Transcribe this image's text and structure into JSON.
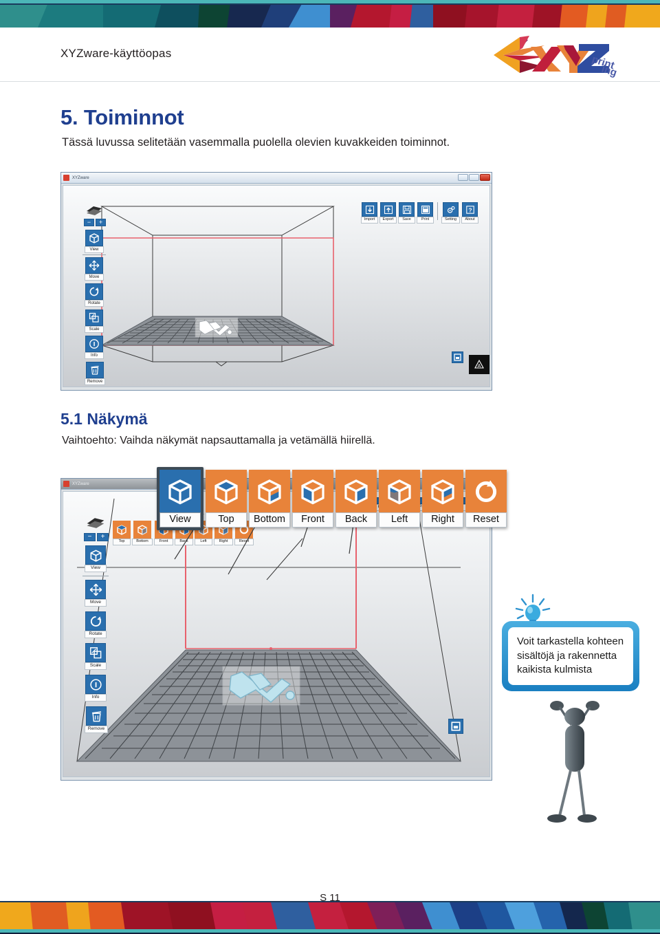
{
  "document": {
    "header_title": "XYZware-käyttöopas",
    "logo_text": "XYZprinting",
    "footer_page": "S 11"
  },
  "section": {
    "number_title": "5. Toiminnot",
    "intro": "Tässä luvussa selitetään vasemmalla puolella olevien kuvakkeiden toiminnot.",
    "sub_number_title": "5.1 Näkymä",
    "sub_intro": "Vaihtoehto: Vaihda näkymät napsauttamalla ja vetämällä hiirellä."
  },
  "app": {
    "window_title": "XYZware",
    "titlebar_buttons": [
      "minimize",
      "maximize",
      "close"
    ],
    "left_rail": {
      "zoom_out": "−",
      "zoom_in": "+",
      "items": [
        {
          "label": "View",
          "icon": "cube-icon"
        },
        {
          "label": "Move",
          "icon": "move-arrows-icon"
        },
        {
          "label": "Rotate",
          "icon": "rotate-icon"
        },
        {
          "label": "Scale",
          "icon": "scale-icon"
        },
        {
          "label": "Info",
          "icon": "info-icon"
        },
        {
          "label": "Remove",
          "icon": "trash-icon"
        }
      ]
    },
    "top_toolbar": [
      {
        "label": "Import",
        "icon": "import-arrow-down-icon"
      },
      {
        "label": "Export",
        "icon": "export-arrow-up-icon"
      },
      {
        "label": "Save",
        "icon": "floppy-disk-icon"
      },
      {
        "label": "Print",
        "icon": "printer-icon"
      },
      {
        "label": "Setting",
        "icon": "gear-icon"
      },
      {
        "label": "About",
        "icon": "question-mark-icon"
      }
    ],
    "top_toolbar_alt": [
      {
        "label": "Import",
        "icon": "import-arrow-down-icon"
      },
      {
        "label": "Export",
        "icon": "export-arrow-up-icon"
      },
      {
        "label": "Save",
        "icon": "floppy-disk-icon"
      },
      {
        "label": "Print",
        "icon": "printer-icon"
      },
      {
        "label": "Settings",
        "icon": "gear-icon"
      },
      {
        "label": "About",
        "icon": "question-mark-icon"
      }
    ],
    "corner_widget": "fit-to-platform-icon",
    "watermark": "A"
  },
  "view_bar": {
    "buttons": [
      {
        "label": "View",
        "icon": "cube-icon",
        "state": "active"
      },
      {
        "label": "Top",
        "icon": "cube-top-icon",
        "state": "normal"
      },
      {
        "label": "Bottom",
        "icon": "cube-bottom-icon",
        "state": "normal"
      },
      {
        "label": "Front",
        "icon": "cube-front-icon",
        "state": "normal"
      },
      {
        "label": "Back",
        "icon": "cube-back-icon",
        "state": "normal"
      },
      {
        "label": "Left",
        "icon": "cube-left-icon",
        "state": "normal"
      },
      {
        "label": "Right",
        "icon": "cube-right-icon",
        "state": "normal"
      },
      {
        "label": "Reset",
        "icon": "reset-circle-icon",
        "state": "normal"
      }
    ]
  },
  "tip": {
    "text": "Voit tarkastella kohteen sisältöjä ja rakennetta kaikista kulmista",
    "icon": "lightbulb-icon",
    "mascot": "stick-figure-holding-sign"
  },
  "colors": {
    "heading_blue": "#1f3f8f",
    "button_blue": "#2a6fae",
    "button_orange": "#e8833a",
    "bubble_blue": "#1a7fc1",
    "teal_rule": "#4bb6b7",
    "envelope_red": "#e8616c"
  }
}
